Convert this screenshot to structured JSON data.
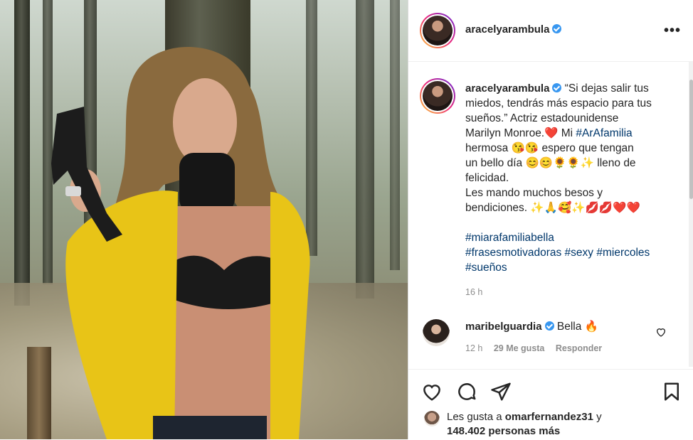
{
  "post": {
    "author": "aracelyarambula",
    "caption_lines": [
      "“Si dejas salir tus",
      "miedos, tendrás más espacio para tus",
      "sueños.” Actriz estadounidense",
      "Marilyn Monroe.❤️ Mi ",
      "hermosa 😘😘 espero que tengan",
      "un bello día 😊😊🌻🌻✨ lleno de",
      "felicidad.",
      "Les mando muchos besos y",
      "bendiciones. ✨🙏🥰✨💋💋❤️❤️"
    ],
    "inline_tag": "#ArAfamilia",
    "hashtag_lines": [
      "#miarafamiliabella",
      "#frasesmotivadoras #sexy #miercoles",
      "#sueños"
    ],
    "time": "16 h"
  },
  "comment": {
    "author": "maribelguardia",
    "text": "Bella 🔥",
    "time": "12 h",
    "likes": "29 Me gusta",
    "reply": "Responder"
  },
  "likes": {
    "prefix": "Les gusta a ",
    "user": "omarfernandez31",
    "suffix": " y",
    "others": "148.402 personas más"
  },
  "more_label": "•••",
  "colors": {
    "verified": "#3897f0",
    "hashtag": "#00376b",
    "jacket": "#e8c417"
  },
  "icons": [
    "heart-icon",
    "comment-icon",
    "share-icon",
    "bookmark-icon",
    "comment-like-icon",
    "more-icon",
    "verified-icon"
  ]
}
